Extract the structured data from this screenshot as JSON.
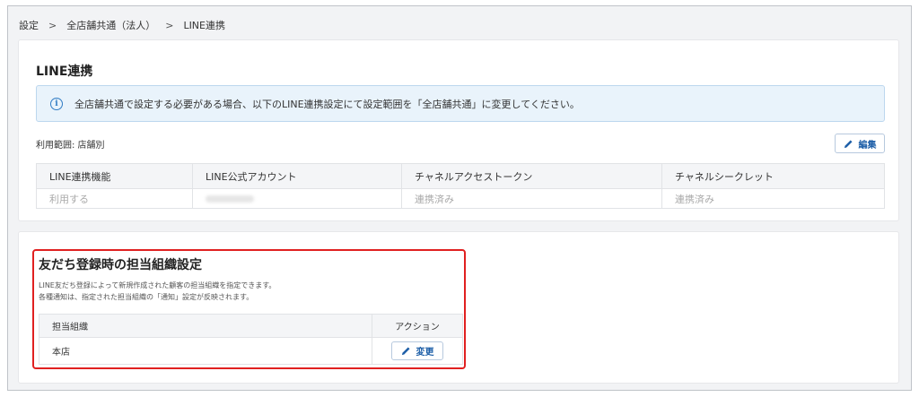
{
  "breadcrumb": {
    "items": [
      "設定",
      "全店舗共通（法人）",
      "LINE連携"
    ],
    "separator": ">"
  },
  "line_section": {
    "title": "LINE連携",
    "info_icon": "info-icon",
    "info_text": "全店舗共通で設定する必要がある場合、以下のLINE連携設定にて設定範囲を「全店舗共通」に変更してください。",
    "scope_text": "利用範囲: 店舗別",
    "edit_icon": "pencil-icon",
    "edit_label": "編集",
    "table": {
      "headers": [
        "LINE連携機能",
        "LINE公式アカウント",
        "チャネルアクセストークン",
        "チャネルシークレット"
      ],
      "rows": [
        [
          "利用する",
          "",
          "連携済み",
          "連携済み"
        ]
      ]
    }
  },
  "org_section": {
    "title": "友だち登録時の担当組織設定",
    "desc_line1": "LINE友だち登録によって新規作成された顧客の担当組織を指定できます。",
    "desc_line2": "各種通知は、指定された担当組織の「通知」設定が反映されます。",
    "table": {
      "headers": [
        "担当組織",
        "アクション"
      ],
      "rows": [
        {
          "org": "本店",
          "action_label": "変更"
        }
      ]
    },
    "change_icon": "pencil-icon"
  },
  "colors": {
    "accent": "#1e5fa8",
    "highlight": "#e02020",
    "info_bg": "#e9f3fb"
  }
}
